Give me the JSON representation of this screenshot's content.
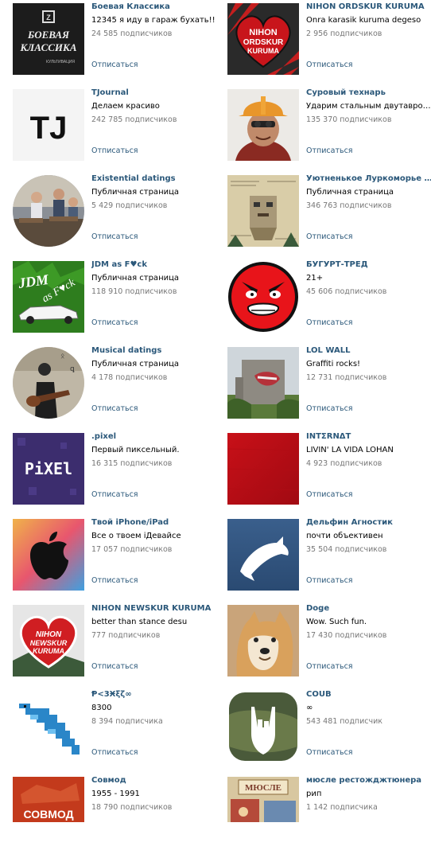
{
  "unsubscribe_label": "Отписаться",
  "communities": [
    {
      "name": "Боевая Классика",
      "status": "12345 я иду в гараж бухать!!",
      "subscribers": "24 585 подписчиков",
      "avatar": "boevaya-klassika-logo",
      "logo_text_1": "БОЕВАЯ",
      "logo_text_2": "КЛАССИКА",
      "logo_text_3": "КУЛЬТИВАЦИЯ"
    },
    {
      "name": "NIHON ORDSKUR KURUMA",
      "status": "Onra karasik kuruma degeso",
      "subscribers": "2 956 подписчиков",
      "avatar": "heart-logo",
      "logo_text_1": "NIHON",
      "logo_text_2": "ORDSKUR",
      "logo_text_3": "KURUMA"
    },
    {
      "name": "TJournal",
      "status": "Делаем красиво",
      "subscribers": "242 785 подписчиков",
      "avatar": "tj-logo",
      "logo_text_1": "TJ"
    },
    {
      "name": "Суровый технарь",
      "status": "Ударим стальным двутавром ...",
      "subscribers": "135 370 подписчиков",
      "avatar": "engineer-photo"
    },
    {
      "name": "Existential datings",
      "status": "Публичная страница",
      "subscribers": "5 429 подписчиков",
      "avatar": "classroom-photo"
    },
    {
      "name": "Уютненькое Луркоморье | ...",
      "status": "Публичная страница",
      "subscribers": "346 763 подписчиков",
      "avatar": "newspaper-collage"
    },
    {
      "name": "JDM as F♥ck",
      "status": "Публичная страница",
      "subscribers": "118 910 подписчиков",
      "avatar": "jdm-car-logo",
      "logo_text_1": "JDM as F♥ck"
    },
    {
      "name": "БУГУРТ-ТРЕД",
      "status": "21+",
      "subscribers": "45 606 подписчиков",
      "avatar": "angry-face"
    },
    {
      "name": "Musical datings",
      "status": "Публичная страница",
      "subscribers": "4 178 подписчиков",
      "avatar": "guitarist-photo"
    },
    {
      "name": "LOL WALL",
      "status": "Graffiti rocks!",
      "subscribers": "12 731 подписчиков",
      "avatar": "graffiti-wall-photo"
    },
    {
      "name": ".pixel",
      "status": "Первый пиксельный.",
      "subscribers": "16 315 подписчиков",
      "avatar": "pixel-logo",
      "logo_text_1": "PiXEl"
    },
    {
      "name": "INTΣRNΔT",
      "status": "LIVIN' LA VIDA LOHAN",
      "subscribers": "4 923 подписчиков",
      "avatar": "red-texture"
    },
    {
      "name": "Твой iPhone/iPad",
      "status": "Все о твоем iДевайсе",
      "subscribers": "17 057 подписчиков",
      "avatar": "apple-logo"
    },
    {
      "name": "Дельфин Агностик",
      "status": "почти объективен",
      "subscribers": "35 504 подписчиков",
      "avatar": "dolphin-logo"
    },
    {
      "name": "NIHON NEWSKUR KURUMA",
      "status": "better than stance desu",
      "subscribers": "777 подписчиков",
      "avatar": "heart-logo-2",
      "logo_text_1": "NIHON",
      "logo_text_2": "NEWSKUR",
      "logo_text_3": "KURUMA"
    },
    {
      "name": "Doge",
      "status": "Wow. Such fun.",
      "subscribers": "17 430 подписчиков",
      "avatar": "doge-photo"
    },
    {
      "name": "Ᵽ<3Ӿξζ∞",
      "status": "8300",
      "subscribers": "8 394 подписчика",
      "avatar": "pixel-dolphin"
    },
    {
      "name": "COUB",
      "status": "∞",
      "subscribers": "543 481 подписчик",
      "avatar": "coub-hand-logo"
    },
    {
      "name": "Совмод",
      "status": "1955 - 1991",
      "subscribers": "18 790 подписчиков",
      "avatar": "sovmod-logo",
      "logo_text_1": "СОВМОД"
    },
    {
      "name": "мюсле рестожджтюнера",
      "status": "рип",
      "subscribers": "1 142 подписчика",
      "avatar": "muesli-photo",
      "logo_text_1": "МЮСЛЕ"
    }
  ],
  "colors": {
    "link": "#2b587a",
    "subs": "#777777",
    "text": "#000000"
  }
}
